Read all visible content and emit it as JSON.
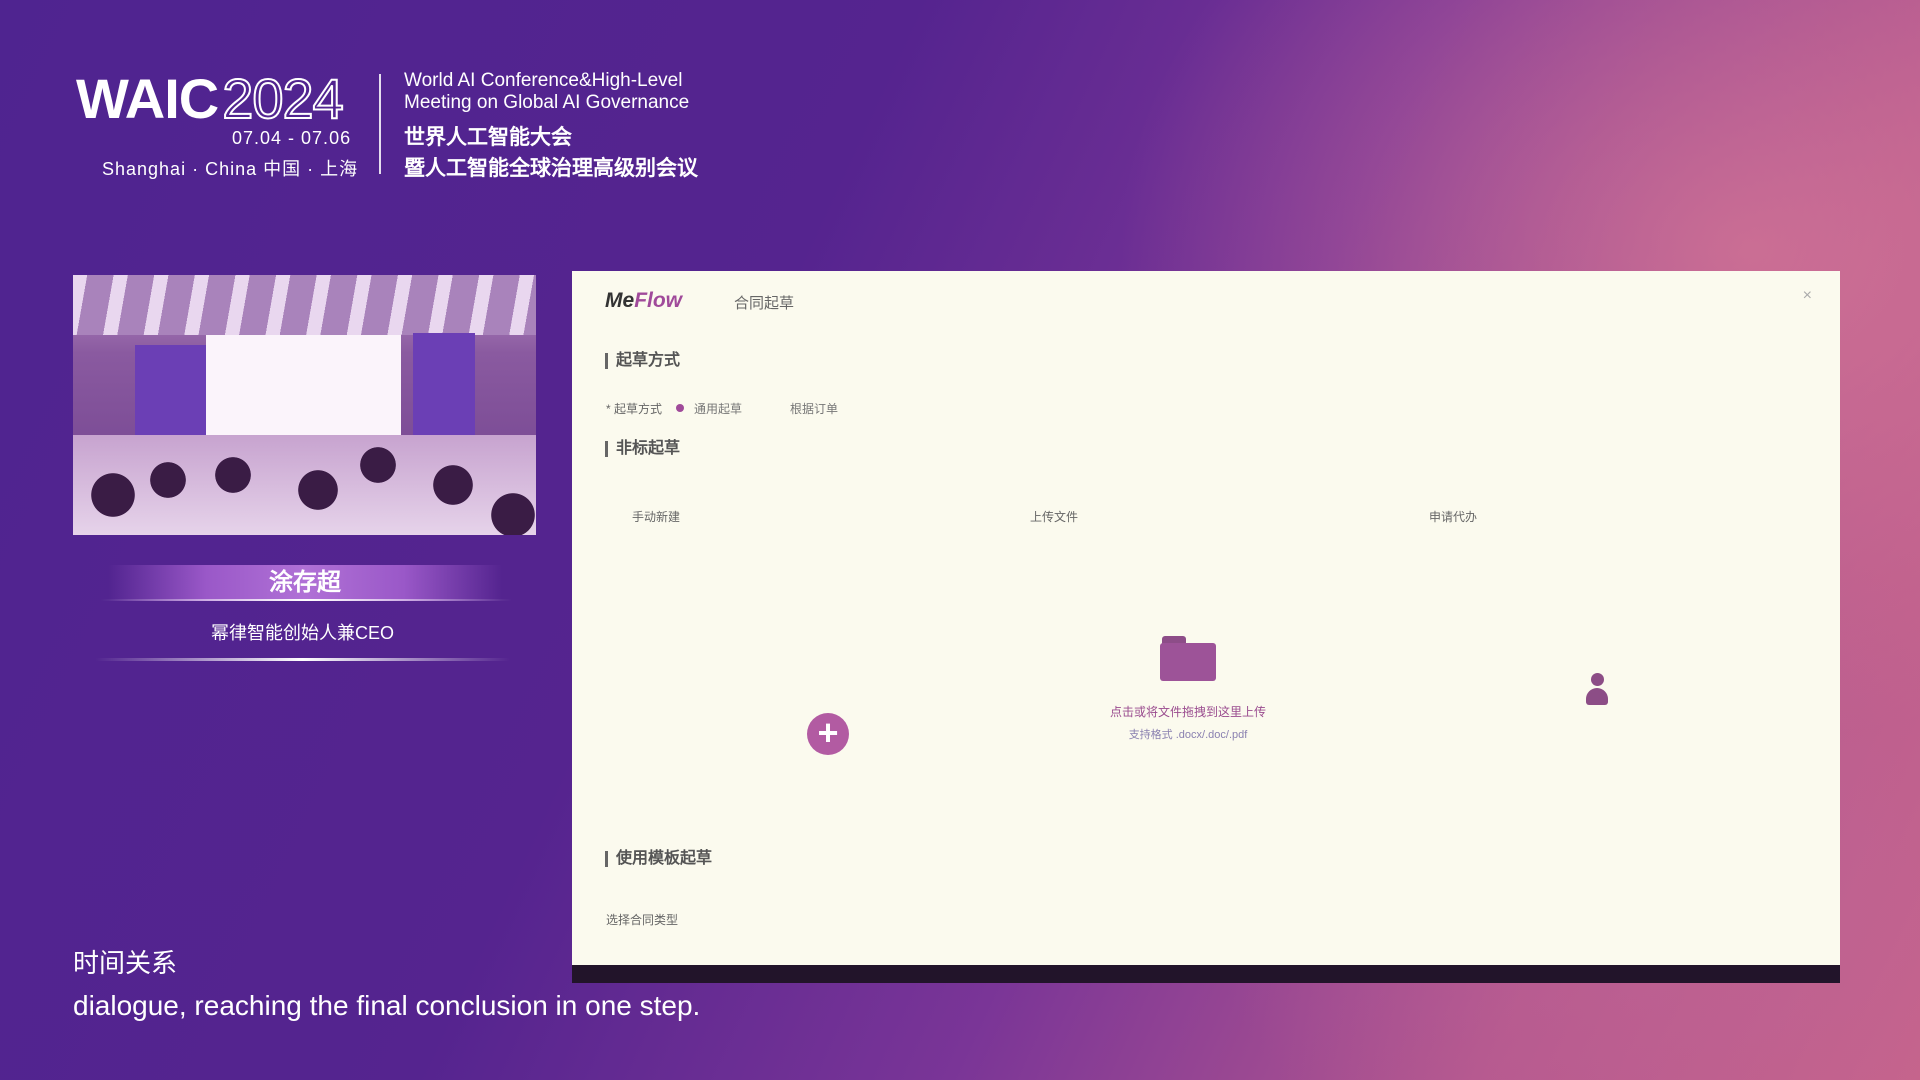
{
  "header": {
    "logo_text": "WAIC",
    "logo_year": "2024",
    "dates": "07.04 - 07.06",
    "location": "Shanghai · China  中国 · 上海",
    "conference_en_line1": "World AI Conference&High-Level",
    "conference_en_line2": "Meeting on Global AI Governance",
    "conference_zh_line1": "世界人工智能大会",
    "conference_zh_line2": "暨人工智能全球治理高级别会议"
  },
  "speaker": {
    "name": "涂存超",
    "title": "幂律智能创始人兼CEO"
  },
  "app": {
    "brand_me": "Me",
    "brand_flow": "Flow",
    "title": "合同起草",
    "close_label": "×",
    "section_draft_method": "起草方式",
    "draft_method_label": "* 起草方式",
    "option_general": "通用起草",
    "option_order": "根据订单",
    "section_nonstandard": "非标起草",
    "col_manual": "手动新建",
    "col_upload": "上传文件",
    "col_apply": "申请代办",
    "upload_hint": "点击或将文件拖拽到这里上传",
    "upload_formats": "支持格式 .docx/.doc/.pdf",
    "section_template": "使用模板起草",
    "template_type_label": "选择合同类型"
  },
  "subtitles": {
    "zh": "时间关系",
    "en": "dialogue, reaching the final conclusion in one step."
  },
  "colors": {
    "accent": "#a04a9a",
    "window_bg": "#fbfaee",
    "page_bg": "#55248f"
  }
}
